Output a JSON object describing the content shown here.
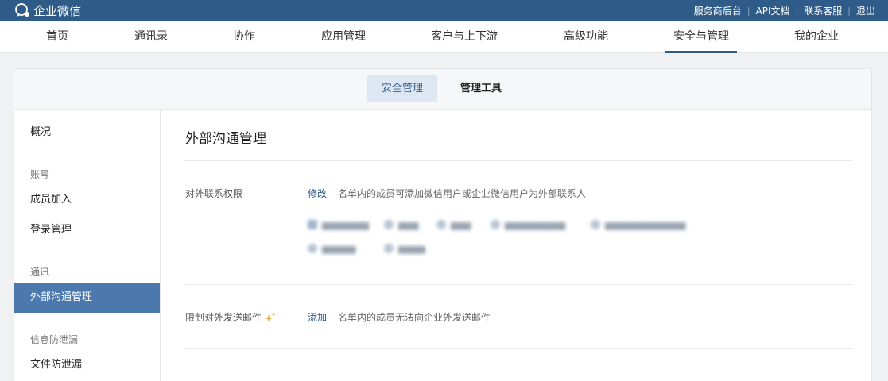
{
  "topbar": {
    "brand": "企业微信",
    "links": [
      "服务商后台",
      "API文档",
      "联系客服",
      "退出"
    ],
    "color": "#2f5b88"
  },
  "nav": {
    "items": [
      "首页",
      "通讯录",
      "协作",
      "应用管理",
      "客户与上下游",
      "高级功能",
      "安全与管理",
      "我的企业"
    ],
    "active_index": 6
  },
  "subtabs": [
    "安全管理",
    "管理工具"
  ],
  "sidebar": {
    "overview": "概况",
    "groups": [
      {
        "title": "账号",
        "items": [
          "成员加入",
          "登录管理"
        ]
      },
      {
        "title": "通讯",
        "items": [
          "外部沟通管理"
        ]
      },
      {
        "title": "信息防泄漏",
        "items": [
          "文件防泄漏"
        ]
      }
    ],
    "active_item": "外部沟通管理",
    "active_color": "#4b78ad"
  },
  "main": {
    "title": "外部沟通管理",
    "rows": [
      {
        "label": "对外联系权限",
        "action": "修改",
        "description": "名单内的成员可添加微信用户或企业微信用户为外部联系人",
        "chips_blurred": true
      },
      {
        "label": "限制对外发送邮件",
        "label_icon": "sparkle-icon",
        "action": "添加",
        "description": "名单内的成员无法向企业外发送邮件"
      }
    ],
    "link_color": "#2f5b88"
  }
}
